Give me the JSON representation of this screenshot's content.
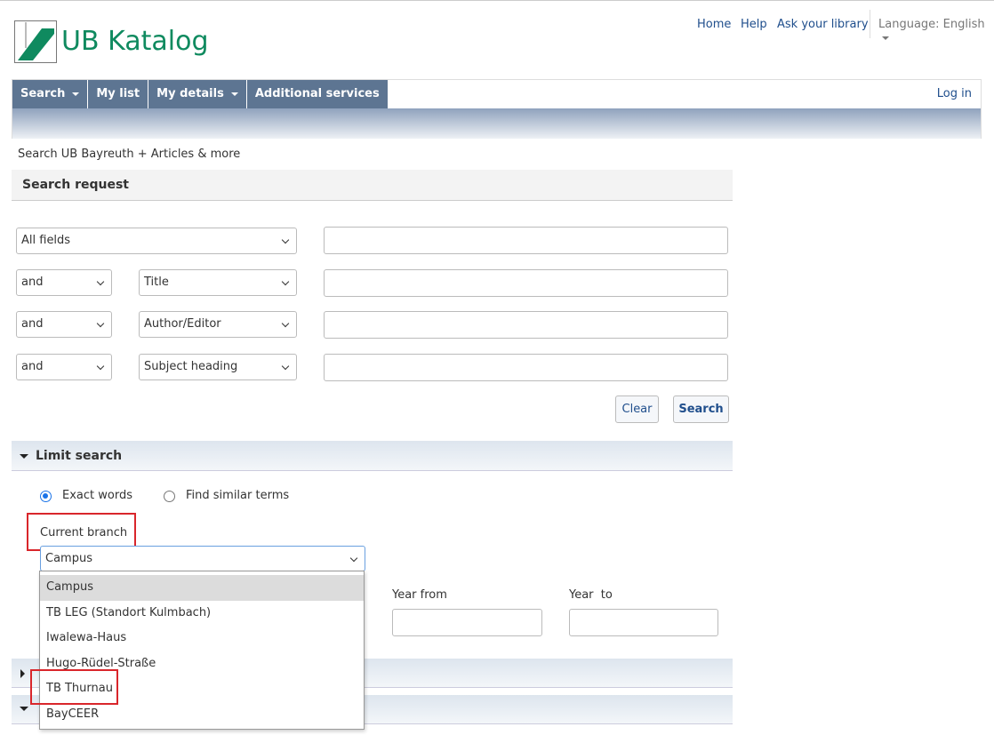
{
  "header": {
    "logo_text": "UB Katalog",
    "links": [
      "Home",
      "Help",
      "Ask your library"
    ],
    "language": "Language: English"
  },
  "nav": {
    "items": [
      "Search",
      "My list",
      "My details",
      "Additional services"
    ],
    "login": "Log in"
  },
  "breadcrumb": "Search UB Bayreuth + Articles & more",
  "search_request": {
    "title": "Search request",
    "rows": [
      {
        "op": null,
        "field": "All fields"
      },
      {
        "op": "and",
        "field": "Title"
      },
      {
        "op": "and",
        "field": "Author/Editor"
      },
      {
        "op": "and",
        "field": "Subject heading"
      }
    ],
    "clear": "Clear",
    "search": "Search"
  },
  "limit": {
    "title": "Limit search",
    "radio_exact": "Exact words",
    "radio_similar": "Find similar terms",
    "selected_radio": "Exact words",
    "branch_label": "Current branch",
    "branch_value": "Campus",
    "branch_options": [
      "Campus",
      "TB LEG (Standort Kulmbach)",
      "Iwalewa-Haus",
      "Hugo-Rüdel-Straße",
      "TB Thurnau",
      "BayCEER"
    ],
    "year_from": "Year from",
    "year_to": "Year  to"
  },
  "colors": {
    "nav": "#5d7592",
    "brand": "#0f8a5f",
    "highlight": "#d9262b"
  }
}
